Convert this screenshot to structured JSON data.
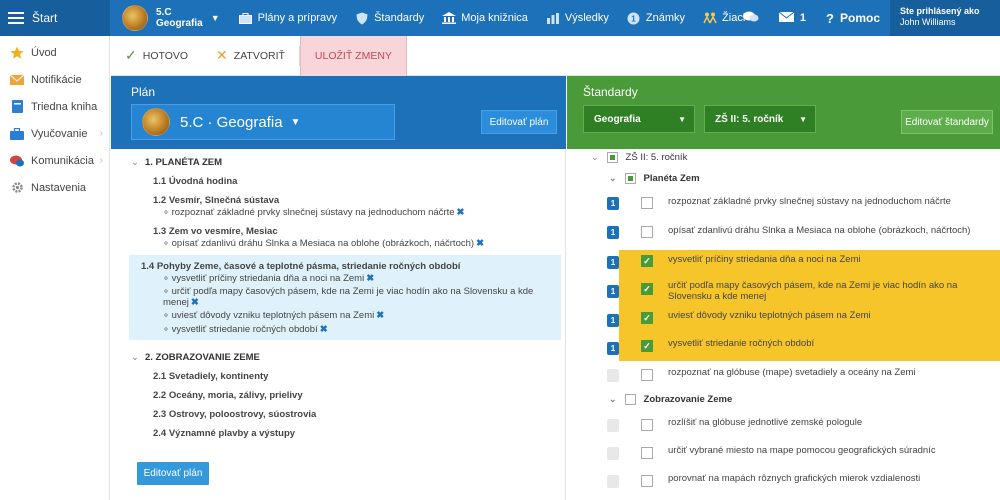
{
  "topbar": {
    "start_label": "Štart",
    "class_line1": "5.C",
    "class_line2": "Geografia",
    "nav": [
      {
        "label": "Plány a prípravy"
      },
      {
        "label": "Štandardy"
      },
      {
        "label": "Moja knižnica"
      },
      {
        "label": "Výsledky"
      },
      {
        "label": "Známky"
      },
      {
        "label": "Žiaci"
      }
    ],
    "mail_count": "1",
    "help_label": "Pomoc",
    "user_line1": "Ste prihlásený ako",
    "user_line2": "John Williams"
  },
  "sidebar": {
    "items": [
      {
        "label": "Úvod"
      },
      {
        "label": "Notifikácie"
      },
      {
        "label": "Triedna kniha"
      },
      {
        "label": "Vyučovanie"
      },
      {
        "label": "Komunikácia"
      },
      {
        "label": "Nastavenia"
      }
    ]
  },
  "actionbar": {
    "done_label": "HOTOVO",
    "close_label": "ZATVORIŤ",
    "save_label": "ULOŽIŤ ZMENY"
  },
  "plan": {
    "title": "Plán",
    "class_label": "5.C · Geografia",
    "edit_label": "Editovať plán",
    "sections": [
      {
        "title": "1. PLANÉTA ZEM"
      },
      {
        "title": "2. ZOBRAZOVANIE ZEME"
      }
    ],
    "lessons": [
      "1.1 Úvodná hodina",
      "1.2 Vesmír, Slnečná sústava",
      "1.3 Zem vo vesmíre, Mesiac",
      "1.4 Pohyby Zeme, časové a teplotné pásma, striedanie ročných období",
      "2.1 Svetadiely, kontinenty",
      "2.2 Oceány, moria, zálivy, prielivy",
      "2.3 Ostrovy, poloostrovy, súostrovia",
      "2.4 Významné plavby a výstupy"
    ],
    "objectives": [
      "rozpoznať základné prvky slnečnej sústavy na jednoduchom náčrte",
      "opísať zdanlivú dráhu Slnka a Mesiaca na oblohe (obrázkoch, náčrtoch)",
      "vysvetliť príčiny striedania dňa a noci na Zemi",
      "určiť podľa mapy časových pásem, kde na Zemi je viac hodín ako na Slovensku a kde menej",
      "uviesť dôvody vzniku teplotných pásem na Zemi",
      "vysvetliť striedanie ročných období"
    ],
    "edit_bottom_label": "Editovať plán"
  },
  "standards": {
    "title": "Štandardy",
    "subject_select": "Geografia",
    "grade_select": "ZŠ II: 5. ročník",
    "edit_label": "Editovať štandardy",
    "groups": [
      {
        "label": "ZŠ II: 5. ročník"
      },
      {
        "label": "Planéta Zem"
      },
      {
        "label": "Zobrazovanie Zeme"
      }
    ],
    "items": [
      {
        "badge": "1",
        "checked": false,
        "text": "rozpoznať základné prvky slnečnej sústavy na jednoduchom náčrte"
      },
      {
        "badge": "1",
        "checked": false,
        "text": "opísať zdanlivú dráhu Slnka a Mesiaca na oblohe (obrázkoch, náčrtoch)"
      },
      {
        "badge": "1",
        "checked": true,
        "text": "vysvetliť príčiny striedania dňa a noci na Zemi"
      },
      {
        "badge": "1",
        "checked": true,
        "text": "určiť podľa mapy časových pásem, kde na Zemi je viac hodín ako na Slovensku a kde menej"
      },
      {
        "badge": "1",
        "checked": true,
        "text": "uviesť dôvody vzniku teplotných pásem na Zemi"
      },
      {
        "badge": "1",
        "checked": true,
        "text": "vysvetliť striedanie ročných období"
      },
      {
        "badge": "",
        "checked": false,
        "text": "rozpoznať na glóbuse (mape) svetadiely a oceány na Zemi"
      },
      {
        "badge": "",
        "checked": false,
        "text": "rozlíšiť na glóbuse jednotlivé zemské pologule"
      },
      {
        "badge": "",
        "checked": false,
        "text": "určiť vybrané miesto na mape pomocou geografických súradníc"
      },
      {
        "badge": "",
        "checked": false,
        "text": "porovnať na mapách rôznych grafických mierok vzdialenosti"
      }
    ]
  },
  "colors": {
    "blue": "#1d71b8",
    "green": "#4a9a3a",
    "yellow": "#f6c529",
    "highlight": "#dff1fb"
  }
}
